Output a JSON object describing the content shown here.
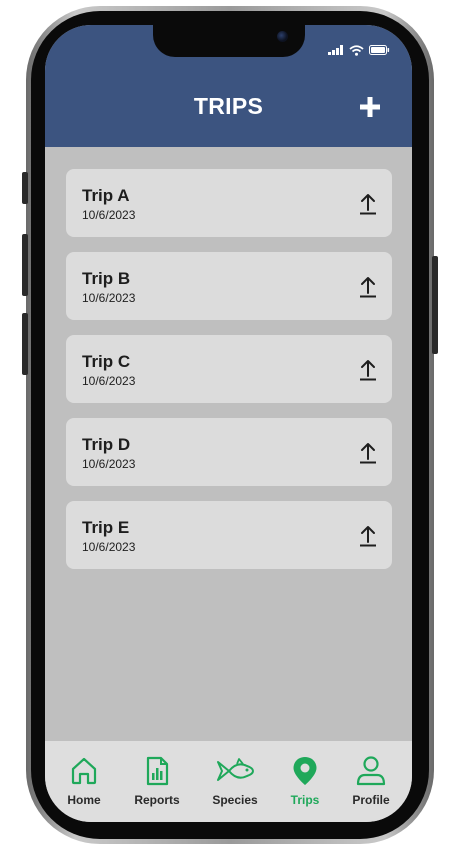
{
  "header": {
    "title": "TRIPS",
    "add_icon": "plus-icon",
    "background_color": "#3c5480"
  },
  "status_bar": {
    "icons": [
      "cellular-signal-icon",
      "wifi-icon",
      "battery-icon"
    ]
  },
  "trips": [
    {
      "name": "Trip A",
      "date": "10/6/2023",
      "action_icon": "upload-icon"
    },
    {
      "name": "Trip B",
      "date": "10/6/2023",
      "action_icon": "upload-icon"
    },
    {
      "name": "Trip C",
      "date": "10/6/2023",
      "action_icon": "upload-icon"
    },
    {
      "name": "Trip D",
      "date": "10/6/2023",
      "action_icon": "upload-icon"
    },
    {
      "name": "Trip E",
      "date": "10/6/2023",
      "action_icon": "upload-icon"
    }
  ],
  "tabbar": {
    "active": "Trips",
    "accent_color": "#1fa85a",
    "tabs": [
      {
        "label": "Home",
        "icon": "home-icon"
      },
      {
        "label": "Reports",
        "icon": "report-chart-icon"
      },
      {
        "label": "Species",
        "icon": "fish-icon"
      },
      {
        "label": "Trips",
        "icon": "map-pin-icon"
      },
      {
        "label": "Profile",
        "icon": "user-icon"
      }
    ]
  }
}
